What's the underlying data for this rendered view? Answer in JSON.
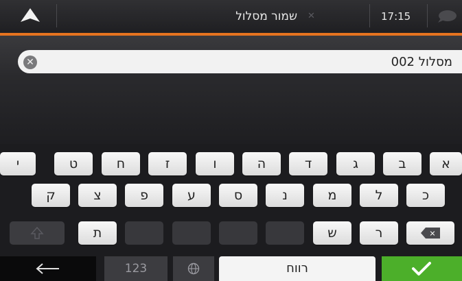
{
  "header": {
    "title": "שמור מסלול",
    "time": "17:15",
    "close_icon": "x-icon",
    "nav_icon": "navigation-arrow-icon",
    "chat_icon": "speech-bubble-icon"
  },
  "field": {
    "value": "מסלול 002",
    "clear_icon": "clear-circle-icon"
  },
  "keyboard": {
    "row1": [
      "י",
      "ט",
      "ח",
      "ז",
      "ו",
      "ה",
      "ד",
      "ג",
      "ב",
      "א"
    ],
    "row2": [
      "ק",
      "צ",
      "פ",
      "ע",
      "ס",
      "נ",
      "מ",
      "ל",
      "כ"
    ],
    "row3": [
      "ת",
      "ש",
      "ר"
    ],
    "bottom": {
      "back_icon": "left-arrow-icon",
      "numbers_label": "123",
      "globe_icon": "globe-icon",
      "space_label": "רווח",
      "done_icon": "checkmark-icon",
      "shift_icon": "shift-icon",
      "backspace_icon": "backspace-icon"
    }
  },
  "colors": {
    "accent": "#e6731f",
    "done_green": "#4caf2a"
  }
}
